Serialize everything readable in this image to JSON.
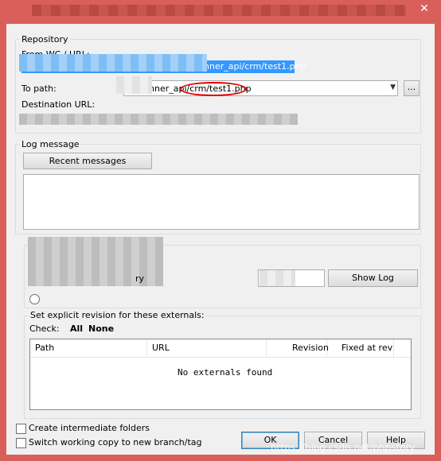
{
  "window": {
    "close_glyph": "✕"
  },
  "repository": {
    "group_label": "Repository",
    "from_label": "From WC / URL:",
    "from_value": "nner_api/crm/test1.php",
    "to_label": "To path:",
    "to_value": "nner_api/crm/test1.php",
    "browse_label": "...",
    "destination_label": "Destination URL:"
  },
  "log": {
    "group_label": "Log message",
    "recent_button": "Recent messages",
    "text": ""
  },
  "revision": {
    "partial_label": "ry",
    "show_log_button": "Show Log"
  },
  "externals": {
    "group_label": "Set explicit revision for these externals:",
    "check_label": "Check:",
    "all_link": "All",
    "none_link": "None",
    "columns": [
      "Path",
      "URL",
      "Revision",
      "Fixed at rev"
    ],
    "empty_message": "No externals found"
  },
  "options": {
    "create_folders": "Create intermediate folders",
    "switch_wc": "Switch working copy to new branch/tag"
  },
  "buttons": {
    "ok": "OK",
    "cancel": "Cancel",
    "help": "Help"
  },
  "watermark": "https://blog.csdn.net/phpstory",
  "colors": {
    "window_frame": "#d9605a",
    "selection": "#3399ff",
    "annotation": "#e00000"
  }
}
